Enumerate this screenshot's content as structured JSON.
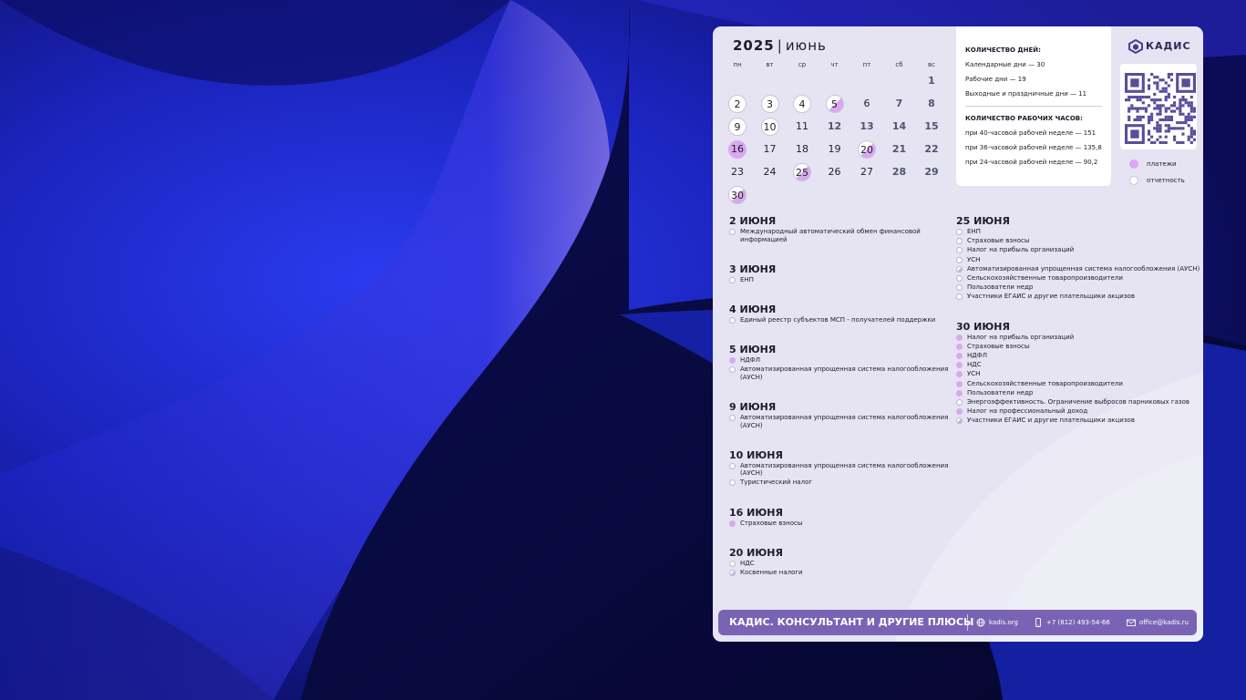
{
  "calendar": {
    "year": "2025",
    "separator": "|",
    "month": "июнь",
    "weekdays": [
      "пн",
      "вт",
      "ср",
      "чт",
      "пт",
      "сб",
      "вс"
    ],
    "days": [
      {
        "n": "1",
        "col": 6,
        "row": 0,
        "weekend": true
      },
      {
        "n": "2",
        "col": 0,
        "row": 1,
        "mark": "report"
      },
      {
        "n": "3",
        "col": 1,
        "row": 1,
        "mark": "report"
      },
      {
        "n": "4",
        "col": 2,
        "row": 1,
        "mark": "report"
      },
      {
        "n": "5",
        "col": 3,
        "row": 1,
        "mark": "both"
      },
      {
        "n": "6",
        "col": 4,
        "row": 1
      },
      {
        "n": "7",
        "col": 5,
        "row": 1,
        "weekend": true
      },
      {
        "n": "8",
        "col": 6,
        "row": 1,
        "weekend": true
      },
      {
        "n": "9",
        "col": 0,
        "row": 2,
        "mark": "report"
      },
      {
        "n": "10",
        "col": 1,
        "row": 2,
        "mark": "report"
      },
      {
        "n": "11",
        "col": 2,
        "row": 2
      },
      {
        "n": "12",
        "col": 3,
        "row": 2,
        "weekend": true
      },
      {
        "n": "13",
        "col": 4,
        "row": 2,
        "weekend": true
      },
      {
        "n": "14",
        "col": 5,
        "row": 2,
        "weekend": true
      },
      {
        "n": "15",
        "col": 6,
        "row": 2,
        "weekend": true
      },
      {
        "n": "16",
        "col": 0,
        "row": 3,
        "mark": "payment"
      },
      {
        "n": "17",
        "col": 1,
        "row": 3
      },
      {
        "n": "18",
        "col": 2,
        "row": 3
      },
      {
        "n": "19",
        "col": 3,
        "row": 3
      },
      {
        "n": "20",
        "col": 4,
        "row": 3,
        "mark": "both"
      },
      {
        "n": "21",
        "col": 5,
        "row": 3,
        "weekend": true
      },
      {
        "n": "22",
        "col": 6,
        "row": 3,
        "weekend": true
      },
      {
        "n": "23",
        "col": 0,
        "row": 4
      },
      {
        "n": "24",
        "col": 1,
        "row": 4
      },
      {
        "n": "25",
        "col": 2,
        "row": 4,
        "mark": "both"
      },
      {
        "n": "26",
        "col": 3,
        "row": 4
      },
      {
        "n": "27",
        "col": 4,
        "row": 4
      },
      {
        "n": "28",
        "col": 5,
        "row": 4,
        "weekend": true
      },
      {
        "n": "29",
        "col": 6,
        "row": 4,
        "weekend": true
      },
      {
        "n": "30",
        "col": 0,
        "row": 5,
        "mark": "both"
      }
    ]
  },
  "stats": {
    "days_heading": "КОЛИЧЕСТВО ДНЕЙ:",
    "calendar_days": "Календарные дни — 30",
    "working_days": "Рабочие дни — 19",
    "holidays": "Выходные и праздничные дни — 11",
    "hours_heading": "КОЛИЧЕСТВО РАБОЧИХ ЧАСОВ:",
    "hours_40": "при 40-часовой рабочей неделе — 151",
    "hours_36": "при 36-часовой рабочей неделе — 135,8",
    "hours_24": "при 24-часовой рабочей неделе — 90,2"
  },
  "brand": {
    "logo_text": "КАДИС"
  },
  "legend": {
    "payments": "платежи",
    "reports": "отчетность"
  },
  "colors": {
    "payment": "#d9a8ef",
    "report": "#ffffff",
    "footer": "#7a63b4",
    "card": "#e6e4f2"
  },
  "events_left": [
    {
      "date": "2 ИЮНЯ",
      "items": [
        {
          "text": "Международный автоматический обмен финансовой",
          "cont": "информацией",
          "mark": "report"
        }
      ]
    },
    {
      "date": "3 ИЮНЯ",
      "items": [
        {
          "text": "ЕНП",
          "mark": "report"
        }
      ]
    },
    {
      "date": "4 ИЮНЯ",
      "items": [
        {
          "text": "Единый реестр субъектов МСП - получателей поддержки",
          "mark": "report"
        }
      ]
    },
    {
      "date": "5 ИЮНЯ",
      "items": [
        {
          "text": "НДФЛ",
          "mark": "payment"
        },
        {
          "text": "Автоматизированная упрощенная система налогообложения",
          "cont": "(АУСН)",
          "mark": "report"
        }
      ]
    },
    {
      "date": "9 ИЮНЯ",
      "items": [
        {
          "text": "Автоматизированная упрощенная система налогообложения",
          "cont": "(АУСН)",
          "mark": "report"
        }
      ]
    },
    {
      "date": "10 ИЮНЯ",
      "items": [
        {
          "text": "Автоматизированная упрощенная система налогообложения",
          "cont": "(АУСН)",
          "mark": "report"
        },
        {
          "text": "Туристический налог",
          "mark": "report"
        }
      ]
    },
    {
      "date": "16 ИЮНЯ",
      "items": [
        {
          "text": "Страховые взносы",
          "mark": "payment"
        }
      ]
    },
    {
      "date": "20 ИЮНЯ",
      "items": [
        {
          "text": "НДС",
          "mark": "report"
        },
        {
          "text": "Косвенные налоги",
          "mark": "both"
        }
      ]
    }
  ],
  "events_right": [
    {
      "date": "25 ИЮНЯ",
      "items": [
        {
          "text": "ЕНП",
          "mark": "report"
        },
        {
          "text": "Страховые взносы",
          "mark": "report"
        },
        {
          "text": "Налог на прибыль организаций",
          "mark": "report"
        },
        {
          "text": "УСН",
          "mark": "report"
        },
        {
          "text": "Автоматизированная упрощенная система налогообложения (АУСН)",
          "mark": "both"
        },
        {
          "text": "Сельскохозяйственные товаропроизводители",
          "mark": "report"
        },
        {
          "text": "Пользователи недр",
          "mark": "report"
        },
        {
          "text": "Участники ЕГАИС и другие плательщики акцизов",
          "mark": "report"
        }
      ]
    },
    {
      "date": "30 ИЮНЯ",
      "items": [
        {
          "text": "Налог на прибыль организаций",
          "mark": "payment"
        },
        {
          "text": "Страховые взносы",
          "mark": "payment"
        },
        {
          "text": "НДФЛ",
          "mark": "payment"
        },
        {
          "text": "НДС",
          "mark": "payment"
        },
        {
          "text": "УСН",
          "mark": "payment"
        },
        {
          "text": "Сельскохозяйственные товаропроизводители",
          "mark": "payment"
        },
        {
          "text": "Пользователи недр",
          "mark": "payment"
        },
        {
          "text": "Энергоэффективность. Ограничение выбросов парниковых газов",
          "mark": "report"
        },
        {
          "text": "Налог на профессиональный доход",
          "mark": "payment"
        },
        {
          "text": "Участники ЕГАИС и другие плательщики акцизов",
          "mark": "both"
        }
      ]
    }
  ],
  "footer": {
    "brand": "КАДИС. КОНСУЛЬТАНТ И ДРУГИЕ ПЛЮСЫ",
    "site": "kadis.org",
    "phone": "+7 (812) 493-54-66",
    "email": "office@kadis.ru"
  }
}
